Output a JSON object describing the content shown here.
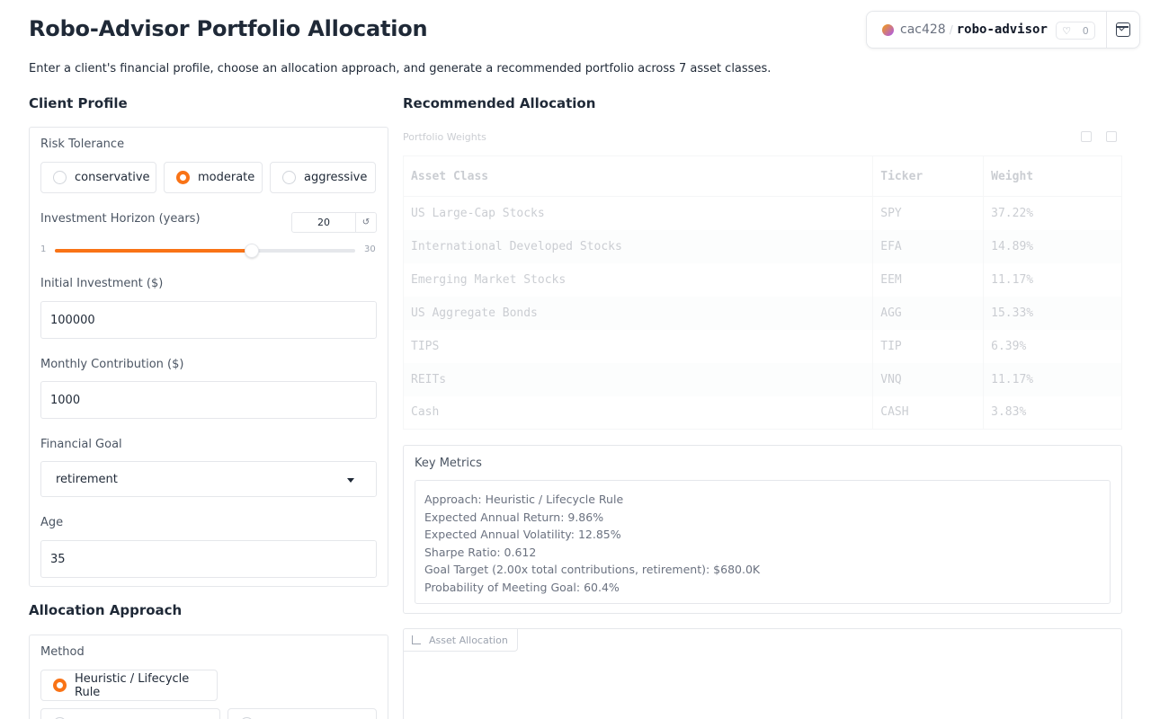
{
  "header": {
    "title": "Robo-Advisor Portfolio Allocation",
    "description": "Enter a client's financial profile, choose an allocation approach, and generate a recommended portfolio across 7 asset classes."
  },
  "space_badge": {
    "owner": "cac428",
    "repo": "robo-advisor",
    "likes": "0"
  },
  "client_profile": {
    "section_title": "Client Profile",
    "risk_label": "Risk Tolerance",
    "risk_options": [
      "conservative",
      "moderate",
      "aggressive"
    ],
    "risk_selected": "moderate",
    "horizon_label": "Investment Horizon (years)",
    "horizon_value": "20",
    "horizon_min": "1",
    "horizon_max": "30",
    "horizon_fraction": 0.655,
    "reset_icon": "↺",
    "initial_label": "Initial Investment ($)",
    "initial_value": "100000",
    "monthly_label": "Monthly Contribution ($)",
    "monthly_value": "1000",
    "goal_label": "Financial Goal",
    "goal_value": "retirement",
    "age_label": "Age",
    "age_value": "35"
  },
  "allocation_approach": {
    "section_title": "Allocation Approach",
    "method_label": "Method",
    "method_option_1": "Heuristic / Lifecycle Rule",
    "method_selected": "Heuristic / Lifecycle Rule"
  },
  "recommended": {
    "section_title": "Recommended Allocation",
    "table_label": "Portfolio Weights",
    "columns": [
      "Asset Class",
      "Ticker",
      "Weight"
    ],
    "rows": [
      [
        "US Large-Cap Stocks",
        "SPY",
        "37.22%"
      ],
      [
        "International Developed Stocks",
        "EFA",
        "14.89%"
      ],
      [
        "Emerging Market Stocks",
        "EEM",
        "11.17%"
      ],
      [
        "US Aggregate Bonds",
        "AGG",
        "15.33%"
      ],
      [
        "TIPS",
        "TIP",
        "6.39%"
      ],
      [
        "REITs",
        "VNQ",
        "11.17%"
      ],
      [
        "Cash",
        "CASH",
        "3.83%"
      ]
    ]
  },
  "metrics": {
    "title": "Key Metrics",
    "lines": [
      "Approach: Heuristic / Lifecycle Rule",
      "Expected Annual Return: 9.86%",
      "Expected Annual Volatility: 12.85%",
      "Sharpe Ratio: 0.612",
      "Goal Target (2.00x total contributions, retirement): $680.0K",
      "Probability of Meeting Goal: 60.4%"
    ]
  },
  "plot": {
    "label": "Asset Allocation"
  }
}
